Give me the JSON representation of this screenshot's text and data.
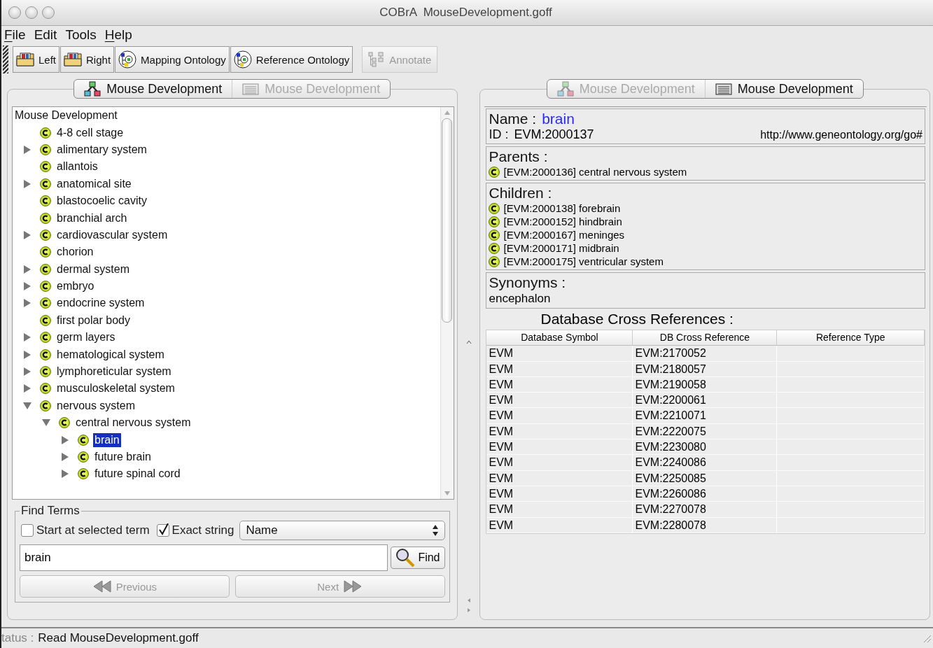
{
  "window": {
    "title": "COBrA  MouseDevelopment.goff"
  },
  "menu": [
    {
      "label": "File",
      "mnemonic": true
    },
    {
      "label": "Edit",
      "mnemonic": false
    },
    {
      "label": "Tools",
      "mnemonic": false
    },
    {
      "label": "Help",
      "mnemonic": true
    }
  ],
  "toolbar": [
    {
      "label": "Left",
      "kind": "folder",
      "disabled": false
    },
    {
      "label": "Right",
      "kind": "folder",
      "disabled": false
    },
    {
      "label": "Mapping Ontology",
      "kind": "ontology",
      "disabled": false
    },
    {
      "label": "Reference Ontology",
      "kind": "ontology",
      "disabled": false
    },
    {
      "label": "Annotate",
      "kind": "annotate",
      "disabled": true
    }
  ],
  "left_panel": {
    "tabs": [
      {
        "label": "Mouse Development",
        "kind": "hierarchy",
        "selected": true
      },
      {
        "label": "Mouse Development",
        "kind": "list",
        "selected": false
      }
    ],
    "tree": {
      "root": "Mouse Development",
      "items": [
        {
          "label": "4-8 cell stage",
          "selected": false
        },
        {
          "label": "alimentary system",
          "expanded": false,
          "selected": false
        },
        {
          "label": "allantois",
          "selected": false
        },
        {
          "label": "anatomical site",
          "expanded": false,
          "selected": false
        },
        {
          "label": "blastocoelic cavity",
          "selected": false
        },
        {
          "label": "branchial arch",
          "selected": false
        },
        {
          "label": "cardiovascular system",
          "expanded": false,
          "selected": false
        },
        {
          "label": "chorion",
          "selected": false
        },
        {
          "label": "dermal system",
          "expanded": false,
          "selected": false
        },
        {
          "label": "embryo",
          "expanded": false,
          "selected": false
        },
        {
          "label": "endocrine system",
          "expanded": false,
          "selected": false
        },
        {
          "label": "first polar body",
          "selected": false
        },
        {
          "label": "germ layers",
          "expanded": false,
          "selected": false
        },
        {
          "label": "hematological system",
          "expanded": false,
          "selected": false
        },
        {
          "label": "lymphoreticular system",
          "expanded": false,
          "selected": false
        },
        {
          "label": "musculoskeletal system",
          "expanded": false,
          "selected": false
        },
        {
          "label": "nervous system",
          "expanded": true,
          "selected": false,
          "children": [
            {
              "label": "central nervous system",
              "expanded": true,
              "selected": false,
              "children": [
                {
                  "label": "brain",
                  "expanded": false,
                  "selected": true
                },
                {
                  "label": "future brain",
                  "expanded": false,
                  "selected": false
                },
                {
                  "label": "future spinal cord",
                  "expanded": false,
                  "selected": false
                }
              ]
            }
          ]
        }
      ]
    },
    "find": {
      "title": "Find Terms",
      "options": [
        {
          "label": "Start at selected term",
          "checked": false
        },
        {
          "label": "Exact string",
          "checked": true
        }
      ],
      "field_select": {
        "value": "Name"
      },
      "search": {
        "value": "brain"
      },
      "find_button": "Find",
      "previous": {
        "label": "Previous",
        "disabled": true
      },
      "next": {
        "label": "Next",
        "disabled": true
      }
    }
  },
  "right_panel": {
    "tabs": [
      {
        "label": "Mouse Development",
        "kind": "hierarchy",
        "selected": false
      },
      {
        "label": "Mouse Development",
        "kind": "list",
        "selected": true
      }
    ],
    "name_label": "Name :",
    "name": "brain",
    "id_label": "ID :",
    "id": "EVM:2000137",
    "namespace": "http://www.geneontology.org/go#",
    "parents": {
      "heading": "Parents :",
      "items": [
        "[EVM:2000136] central nervous system"
      ]
    },
    "children": {
      "heading": "Children :",
      "items": [
        "[EVM:2000138] forebrain",
        "[EVM:2000152] hindbrain",
        "[EVM:2000167] meninges",
        "[EVM:2000171] midbrain",
        "[EVM:2000175] ventricular system"
      ]
    },
    "synonyms": {
      "heading": "Synonyms :",
      "items": [
        "encephalon"
      ]
    },
    "xrefs": {
      "title": "Database Cross References :",
      "columns": [
        "Database Symbol",
        "DB Cross Reference",
        "Reference Type"
      ],
      "rows": [
        [
          "EVM",
          "EVM:2170052"
        ],
        [
          "EVM",
          "EVM:2180057"
        ],
        [
          "EVM",
          "EVM:2190058"
        ],
        [
          "EVM",
          "EVM:2200061"
        ],
        [
          "EVM",
          "EVM:2210071"
        ],
        [
          "EVM",
          "EVM:2220075"
        ],
        [
          "EVM",
          "EVM:2230080"
        ],
        [
          "EVM",
          "EVM:2240086"
        ],
        [
          "EVM",
          "EVM:2250085"
        ],
        [
          "EVM",
          "EVM:2260086"
        ],
        [
          "EVM",
          "EVM:2270078"
        ],
        [
          "EVM",
          "EVM:2280078"
        ]
      ]
    }
  },
  "status_bar": {
    "label": "tatus :",
    "text": "Read MouseDevelopment.goff"
  }
}
